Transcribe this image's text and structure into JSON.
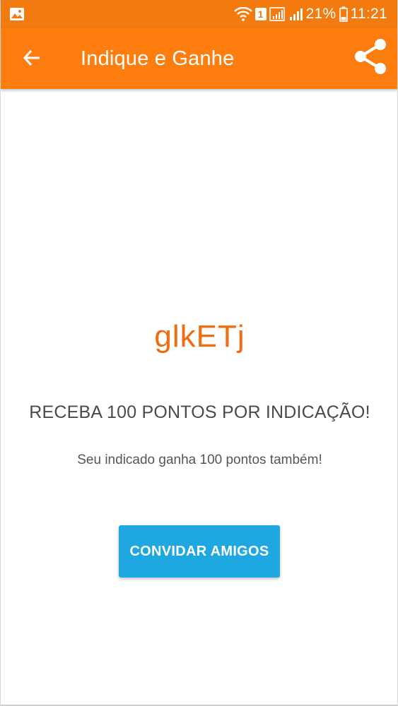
{
  "status_bar": {
    "sim_label": "1",
    "battery_percent": "21%",
    "time": "11:21",
    "icons": [
      "image-notification-icon",
      "wifi-icon",
      "signal-icon",
      "battery-icon"
    ]
  },
  "app_bar": {
    "title": "Indique e Ganhe",
    "back_icon": "arrow-left-icon",
    "share_icon": "share-icon"
  },
  "content": {
    "referral_code": "glkETj",
    "headline": "RECEBA 100 PONTOS POR INDICAÇÃO!",
    "subline": "Seu indicado ganha 100 pontos também!",
    "invite_button_label": "CONVIDAR AMIGOS"
  },
  "colors": {
    "status_bar": "#f27a0e",
    "app_bar": "#fd7d0e",
    "code_text": "#ef6c10",
    "button": "#1ea7e1"
  }
}
